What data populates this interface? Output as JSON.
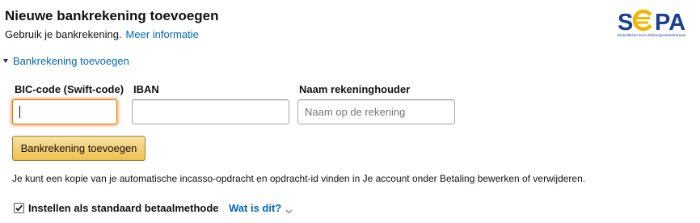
{
  "header": {
    "title": "Nieuwe bankrekening toevoegen",
    "subtitle": "Gebruik je bankrekening.",
    "more_info_link": "Meer informatie"
  },
  "sepa_logo": {
    "text": "SEPA",
    "tagline": "Einheitlicher Euro-Zahlungsverkehrsraum",
    "colors": {
      "blue": "#1c3f94",
      "yellow": "#f4b400"
    }
  },
  "section": {
    "toggle_label": "Bankrekening toevoegen"
  },
  "form": {
    "bic_label": "BIC-code (Swift-code)",
    "bic_value": "",
    "iban_label": "IBAN",
    "iban_value": "",
    "holder_label": "Naam rekeninghouder",
    "holder_placeholder": "Naam op de rekening",
    "submit_label": "Bankrekening toevoegen"
  },
  "note": "Je kunt een kopie van je automatische incasso-opdracht en opdracht-id vinden in Je account onder Betaling bewerken of verwijderen.",
  "default_option": {
    "checked": true,
    "label": "Instellen als standaard betaalmethode",
    "help_link": "Wat is dit?"
  },
  "colors": {
    "link": "#0066c0",
    "button_top": "#f7dfa5",
    "button_bottom": "#f0c14b",
    "focus": "#e77600"
  }
}
